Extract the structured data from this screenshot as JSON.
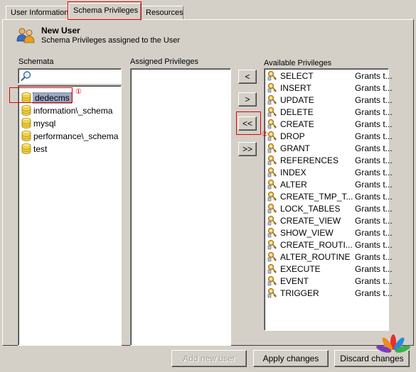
{
  "tabs": [
    {
      "label": "User Information"
    },
    {
      "label": "Schema Privileges"
    },
    {
      "label": "Resources"
    }
  ],
  "header": {
    "title": "New User",
    "subtitle": "Schema Privileges assigned to the User"
  },
  "schemata": {
    "label": "Schemata",
    "search_value": "",
    "items": [
      {
        "label": "dedecms"
      },
      {
        "label": "information\\_schema"
      },
      {
        "label": "mysql"
      },
      {
        "label": "performance\\_schema"
      },
      {
        "label": "test"
      }
    ]
  },
  "assigned": {
    "label": "Assigned Privileges"
  },
  "move_buttons": {
    "add_one": "<",
    "remove_one": ">",
    "add_all": "<<",
    "remove_all": ">>"
  },
  "available": {
    "label": "Available Privileges",
    "items": [
      {
        "name": "SELECT",
        "desc": "Grants t..."
      },
      {
        "name": "INSERT",
        "desc": "Grants t..."
      },
      {
        "name": "UPDATE",
        "desc": "Grants t..."
      },
      {
        "name": "DELETE",
        "desc": "Grants t..."
      },
      {
        "name": "CREATE",
        "desc": "Grants t..."
      },
      {
        "name": "DROP",
        "desc": "Grants t..."
      },
      {
        "name": "GRANT",
        "desc": "Grants t..."
      },
      {
        "name": "REFERENCES",
        "desc": "Grants t..."
      },
      {
        "name": "INDEX",
        "desc": "Grants t..."
      },
      {
        "name": "ALTER",
        "desc": "Grants t..."
      },
      {
        "name": "CREATE_TMP_T...",
        "desc": "Grants t..."
      },
      {
        "name": "LOCK_TABLES",
        "desc": "Grants t..."
      },
      {
        "name": "CREATE_VIEW",
        "desc": "Grants t..."
      },
      {
        "name": "SHOW_VIEW",
        "desc": "Grants t..."
      },
      {
        "name": "CREATE_ROUTI...",
        "desc": "Grants t..."
      },
      {
        "name": "ALTER_ROUTINE",
        "desc": "Grants t..."
      },
      {
        "name": "EXECUTE",
        "desc": "Grants t..."
      },
      {
        "name": "EVENT",
        "desc": "Grants t..."
      },
      {
        "name": "TRIGGER",
        "desc": "Grants t..."
      }
    ]
  },
  "annotations": {
    "marker_1": "①",
    "marker_2": "②"
  },
  "footer": {
    "add_user": "Add new user",
    "apply": "Apply changes",
    "discard": "Discard changes"
  },
  "icons": {
    "user": "users-icon",
    "search": "magnifier-icon",
    "database": "database-icon",
    "privilege": "key-icon"
  }
}
